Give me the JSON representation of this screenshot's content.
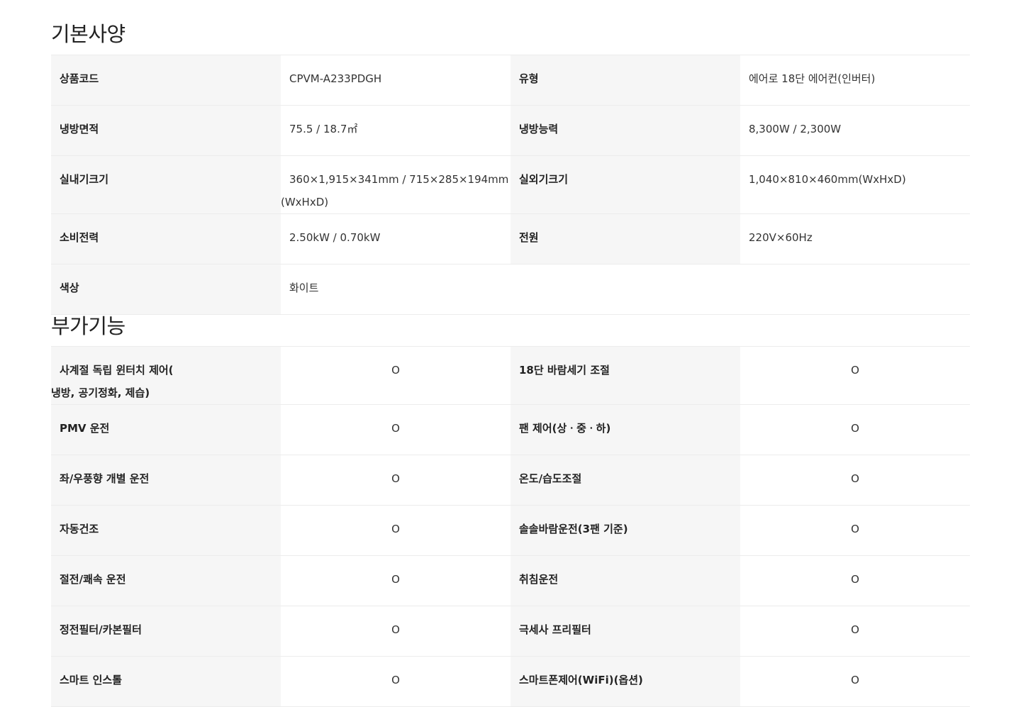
{
  "basic_section": {
    "title": "기본사양",
    "rows": [
      [
        {
          "label": "상품코드",
          "value": "CPVM-A233PDGH"
        },
        {
          "label": "유형",
          "value": "에어로 18단 에어컨(인버터)"
        }
      ],
      [
        {
          "label": "냉방면적",
          "value": "75.5 / 18.7㎡"
        },
        {
          "label": "냉방능력",
          "value": "8,300W / 2,300W"
        }
      ],
      [
        {
          "label": "실내기크기",
          "value_line1": "360×1,915×341mm / 715×285×194mm",
          "value_line2": "(WxHxD)"
        },
        {
          "label": "실외기크기",
          "value": "1,040×810×460mm(WxHxD)"
        }
      ],
      [
        {
          "label": "소비전력",
          "value": "2.50kW / 0.70kW"
        },
        {
          "label": "전원",
          "value": "220V×60Hz"
        }
      ],
      [
        {
          "label": "색상",
          "value": "화이트"
        }
      ]
    ]
  },
  "extra_section": {
    "title": "부가기능",
    "rows": [
      [
        {
          "label_line1": "사계절 독립 윈터치 제어(",
          "label_line2": "냉방, 공기정화, 제습)",
          "value": "O"
        },
        {
          "label": "18단 바람세기 조절",
          "value": "O"
        }
      ],
      [
        {
          "label": "PMV 운전",
          "value": "O"
        },
        {
          "label": "팬 제어(상ㆍ중ㆍ하)",
          "value": "O"
        }
      ],
      [
        {
          "label": "좌/우풍향 개별 운전",
          "value": "O"
        },
        {
          "label": "온도/습도조절",
          "value": "O"
        }
      ],
      [
        {
          "label": "자동건조",
          "value": "O"
        },
        {
          "label": "솔솔바람운전(3팬 기준)",
          "value": "O"
        }
      ],
      [
        {
          "label": "절전/쾌속 운전",
          "value": "O"
        },
        {
          "label": "취침운전",
          "value": "O"
        }
      ],
      [
        {
          "label": "정전필터/카본필터",
          "value": "O"
        },
        {
          "label": "극세사 프리필터",
          "value": "O"
        }
      ],
      [
        {
          "label": "스마트 인스톨",
          "value": "O"
        },
        {
          "label": "스마트폰제어(WiFi)(옵션)",
          "value": "O"
        }
      ]
    ]
  }
}
